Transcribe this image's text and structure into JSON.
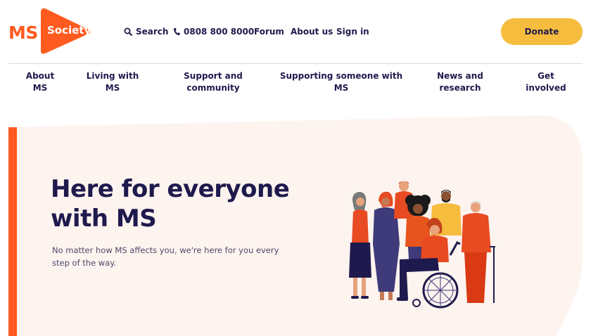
{
  "logo": {
    "ms": "MS",
    "society": "Society"
  },
  "utility_nav": [
    {
      "icon": "search-icon",
      "label": "Search"
    },
    {
      "icon": "phone-icon",
      "label": "0808 800 8000"
    },
    {
      "label": "Forum"
    },
    {
      "label": "About us"
    },
    {
      "label": "Sign in"
    }
  ],
  "donate": {
    "label": "Donate"
  },
  "main_nav": [
    {
      "line1": "About",
      "line2": "MS"
    },
    {
      "line1": "Living with",
      "line2": "MS"
    },
    {
      "line1": "Support and",
      "line2": "community"
    },
    {
      "line1": "Supporting someone with",
      "line2": "MS"
    },
    {
      "line1": "News and",
      "line2": "research"
    },
    {
      "line1": "Get",
      "line2": "involved"
    }
  ],
  "hero": {
    "title_line1": "Here for everyone",
    "title_line2": "with MS",
    "subtitle": "No matter how MS affects you, we're here for you every step of the way."
  },
  "colors": {
    "brand_orange": "#ff5a1f",
    "navy": "#1f1a4d",
    "donate_yellow": "#f6bc3d",
    "hero_bg": "#fdf3ef"
  }
}
